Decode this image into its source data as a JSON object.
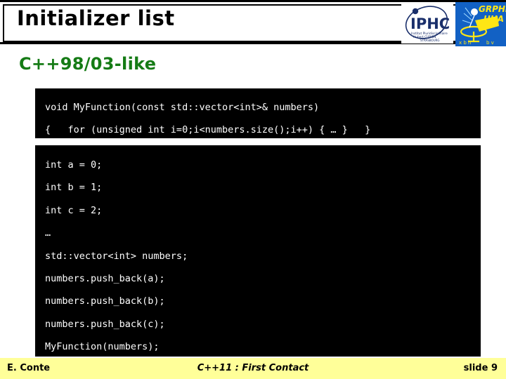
{
  "header": {
    "title": "Initializer list",
    "logos": [
      {
        "name": "iphc-logo",
        "acronym": "IPHC",
        "line1": "Institut Pluridisciplinaire",
        "line2": "Hubert CURIEN",
        "line3": "STRASBOURG",
        "color": "#1a2f6b"
      },
      {
        "name": "grphe-uha-logo",
        "line1": "GRPHE",
        "line2": "UHA",
        "background": "#1261c4",
        "color": "#ffe615"
      }
    ]
  },
  "section": {
    "heading": "C++98/03-like",
    "heading_color": "#157b15"
  },
  "code_blocks": [
    {
      "name": "function-definition-block",
      "background": "#000000",
      "text_color": "#ffffff",
      "lines": [
        "void MyFunction(const std::vector<int>& numbers)",
        "{   for (unsigned int i=0;i<numbers.size();i++) { … }   }"
      ]
    },
    {
      "name": "usage-block",
      "background": "#000000",
      "text_color": "#ffffff",
      "lines": [
        "int a = 0;",
        "int b = 1;",
        "int c = 2;",
        "…",
        "std::vector<int> numbers;",
        "numbers.push_back(a);",
        "numbers.push_back(b);",
        "numbers.push_back(c);",
        "MyFunction(numbers);"
      ]
    }
  ],
  "footer": {
    "author": "E. Conte",
    "talk_title": "C++11 : First Contact",
    "slide_number": "slide 9",
    "background": "#ffff99"
  }
}
